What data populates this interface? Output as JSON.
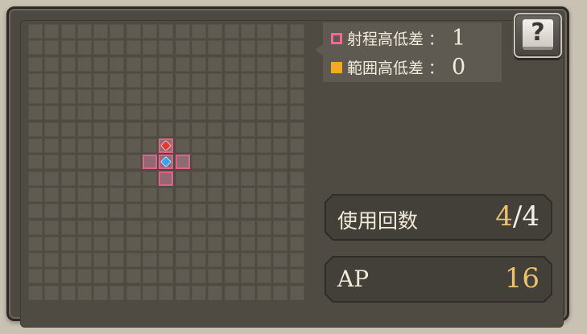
{
  "colors": {
    "range_cell": "#e2608a",
    "target_marker": "#e03a3a",
    "origin_marker": "#3aa0f0",
    "accent_value": "#e9c26a",
    "range_swatch": "#f06b94",
    "area_swatch": "#f5a824"
  },
  "grid": {
    "columns": 17,
    "rows": 17,
    "range_cells": [
      [
        8,
        7
      ],
      [
        7,
        8
      ],
      [
        8,
        8
      ],
      [
        9,
        8
      ],
      [
        8,
        9
      ]
    ],
    "target_cell": [
      8,
      7
    ],
    "origin_cell": [
      8,
      8
    ]
  },
  "legend": {
    "range_height": {
      "label": "射程高低差",
      "colon": "：",
      "value": "1",
      "icon": "pink-square-outline-icon"
    },
    "area_height": {
      "label": "範囲高低差",
      "colon": "：",
      "value": "0",
      "icon": "orange-square-icon"
    }
  },
  "help_button": {
    "glyph": "?",
    "icon": "help-book-icon"
  },
  "usage": {
    "label": "使用回数",
    "current": "4",
    "slash": "/",
    "max": "4"
  },
  "ap": {
    "label": "AP",
    "value": "16"
  }
}
